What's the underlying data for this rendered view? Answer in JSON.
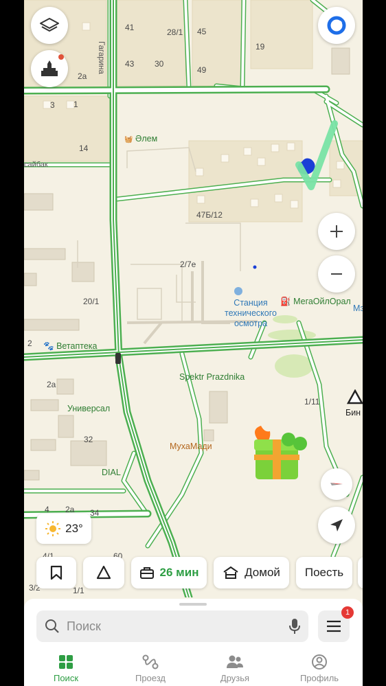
{
  "map": {
    "street_labels": {
      "gagarina": "Гагарина",
      "saybak": "сайбак"
    },
    "house_numbers": {
      "n41": "41",
      "n28_1": "28/1",
      "n45": "45",
      "n19": "19",
      "n43": "43",
      "n30": "30",
      "n49": "49",
      "n2a_top": "2а",
      "n3": "3",
      "n1": "1",
      "n14": "14",
      "n47b12": "47Б/12",
      "n2_7e": "2/7е",
      "n20_1": "20/1",
      "n2": "2",
      "n2a_mid": "2а",
      "n32": "32",
      "n4": "4",
      "n2a_low": "2а",
      "n34": "34",
      "n60": "60",
      "n4_1": "4/1",
      "n3_2": "3/2",
      "n1_1": "1/1",
      "n1_11": "1/11"
    },
    "pois": {
      "alem": "Әлем",
      "station": "Станция технического осмотра",
      "megaoil": "МегаОйлОрал",
      "mz": "Мэ",
      "vetapteka": "Ветаптека",
      "spektr": "Spektr Prazdnika",
      "universal": "Универсал",
      "mukhamadi": "МухаМади",
      "dial": "DIAL",
      "bin": "Бин"
    }
  },
  "weather": {
    "temperature": "23°"
  },
  "chips": {
    "work_time": "26 мин",
    "home_label": "Домой",
    "eat_label": "Поесть"
  },
  "search": {
    "placeholder": "Поиск"
  },
  "menu": {
    "badge_count": "1"
  },
  "tabs": [
    {
      "label": "Поиск",
      "icon": "grid-icon",
      "active": true
    },
    {
      "label": "Проезд",
      "icon": "route-icon",
      "active": false
    },
    {
      "label": "Друзья",
      "icon": "friends-icon",
      "active": false
    },
    {
      "label": "Профиль",
      "icon": "profile-icon",
      "active": false
    }
  ],
  "colors": {
    "road_outline": "#4caf50",
    "road_fill": "#ffffff",
    "map_bg": "#f5f1e4",
    "building": "#ece4cc",
    "accent_green": "#2e9e44",
    "badge_red": "#e53935",
    "annotation_check": "#79e3a5",
    "annotation_blob": "#1a3fd6"
  }
}
